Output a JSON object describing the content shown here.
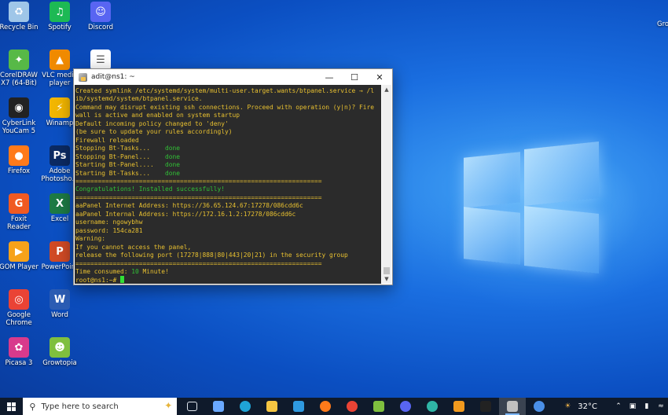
{
  "desktop": {
    "icons": [
      {
        "label": "Recycle Bin",
        "icon": "recycle-bin-icon",
        "color": "#9fc6e8"
      },
      {
        "label": "Spotify",
        "icon": "spotify-icon",
        "color": "#1db954"
      },
      {
        "label": "Discord",
        "icon": "discord-icon",
        "color": "#5865f2"
      },
      {
        "label": "CorelDRAW X7 (64-Bit)",
        "icon": "coreldraw-icon",
        "color": "#57b947"
      },
      {
        "label": "VLC media player",
        "icon": "vlc-icon",
        "color": "#f08a00"
      },
      {
        "label": "",
        "icon": "text-file-icon",
        "color": "#ffffff"
      },
      {
        "label": "CyberLink YouCam 5",
        "icon": "youcam-icon",
        "color": "#222222"
      },
      {
        "label": "Winamp",
        "icon": "winamp-icon",
        "color": "#f2b600"
      },
      {
        "label": "Firefox",
        "icon": "firefox-icon",
        "color": "#ff7a1a"
      },
      {
        "label": "Adobe Photosho...",
        "icon": "photoshop-icon",
        "color": "#0b2a63"
      },
      {
        "label": "Foxit Reader",
        "icon": "foxit-icon",
        "color": "#f05a22"
      },
      {
        "label": "Excel",
        "icon": "excel-icon",
        "color": "#1d7a44"
      },
      {
        "label": "GOM Player",
        "icon": "gom-player-icon",
        "color": "#f6a21a"
      },
      {
        "label": "PowerPoint",
        "icon": "powerpoint-icon",
        "color": "#d04a25"
      },
      {
        "label": "Google Chrome",
        "icon": "chrome-icon",
        "color": "#ea4335"
      },
      {
        "label": "Word",
        "icon": "word-icon",
        "color": "#2b5cb3"
      },
      {
        "label": "Picasa 3",
        "icon": "picasa-icon",
        "color": "#d83a8c"
      },
      {
        "label": "Growtopia",
        "icon": "growtopia-icon",
        "color": "#7fbf3f"
      }
    ],
    "edge_label": "Gro"
  },
  "terminal": {
    "title": "adit@ns1: ~",
    "lines": [
      "Created symlink /etc/systemd/system/multi-user.target.wants/btpanel.service → /l",
      "ib/systemd/system/btpanel.service.",
      "Command may disrupt existing ssh connections. Proceed with operation (y|n)? Fire",
      "wall is active and enabled on system startup",
      "Default incoming policy changed to 'deny'",
      "(be sure to update your rules accordingly)",
      "Firewall reloaded"
    ],
    "status_lines": [
      {
        "text": "Stopping Bt-Tasks...    ",
        "status": "done"
      },
      {
        "text": "Stopping Bt-Panel...    ",
        "status": "done"
      },
      {
        "text": "Starting Bt-Panel....   ",
        "status": "done"
      },
      {
        "text": "Starting Bt-Tasks...    ",
        "status": "done"
      }
    ],
    "separator": "==================================================================",
    "success": "Congratulations! Installed successfully!",
    "info_lines": [
      "aaPanel Internet Address: https://36.65.124.67:17278/086cdd6c",
      "aaPanel Internal Address: https://172.16.1.2:17278/086cdd6c",
      "username: ngowybhw",
      "password: 154ca281",
      "Warning:",
      "If you cannot access the panel,",
      "release the following port (17278|888|80|443|20|21) in the security group"
    ],
    "time_prefix": "Time consumed: ",
    "time_value": "10",
    "time_suffix": " Minute!",
    "prompt": "root@ns1:~# "
  },
  "taskbar": {
    "search_placeholder": "Type here to search",
    "apps": [
      {
        "icon": "task-view-icon",
        "color": "#dfe6ee"
      },
      {
        "icon": "copilot-icon",
        "color": "#6aa9ff"
      },
      {
        "icon": "edge-icon",
        "color": "#1fa4d6"
      },
      {
        "icon": "file-explorer-icon",
        "color": "#f4c542"
      },
      {
        "icon": "microsoft-store-icon",
        "color": "#2f9ae0"
      },
      {
        "icon": "firefox-icon",
        "color": "#ff7a1a"
      },
      {
        "icon": "chrome-icon",
        "color": "#ea4335"
      },
      {
        "icon": "growtopia-icon",
        "color": "#7fbf3f"
      },
      {
        "icon": "discord-icon",
        "color": "#5865f2"
      },
      {
        "icon": "edge-dev-icon",
        "color": "#2fb5a6"
      },
      {
        "icon": "remote-desktop-icon",
        "color": "#f29a1e"
      },
      {
        "icon": "terminal-icon",
        "color": "#222222"
      },
      {
        "icon": "putty-icon",
        "color": "#c0c0c0"
      },
      {
        "icon": "vpn-icon",
        "color": "#4a8fe7"
      }
    ],
    "temperature": "32°C"
  }
}
